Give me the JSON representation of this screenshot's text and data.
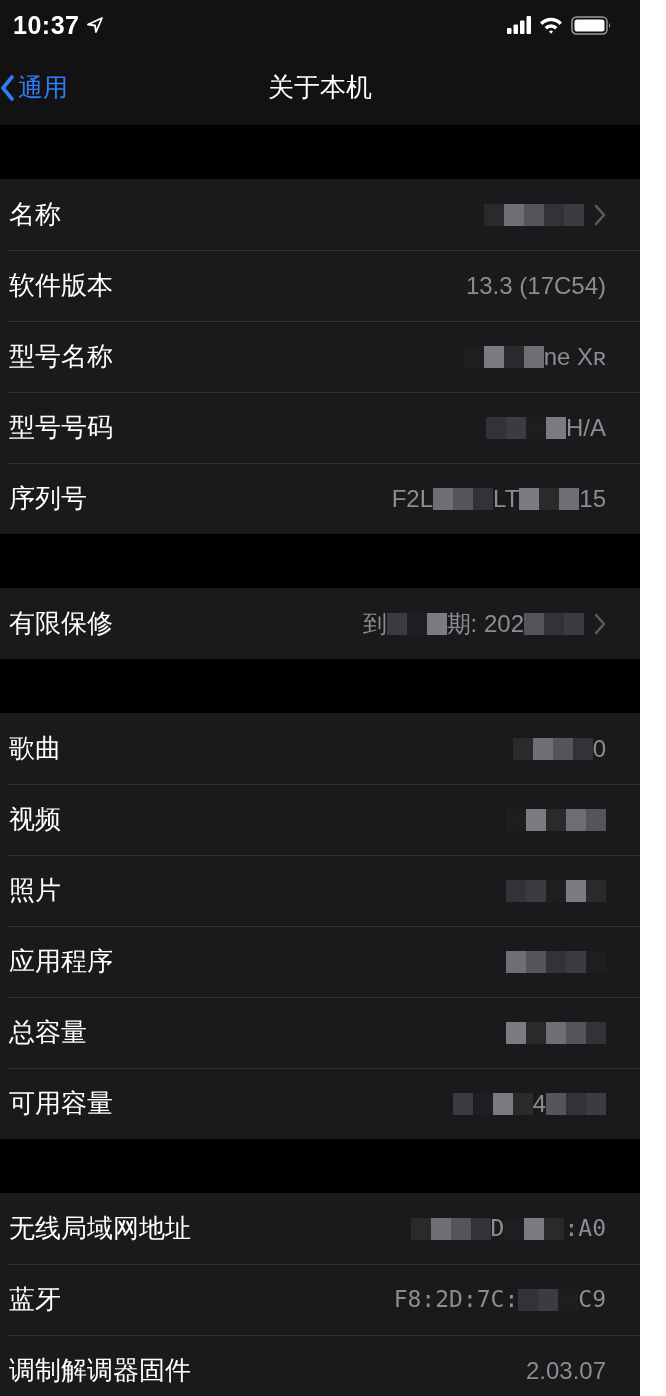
{
  "status_bar": {
    "time": "10:37"
  },
  "nav": {
    "back": "通用",
    "title": "关于本机"
  },
  "groups": [
    {
      "rows": [
        {
          "label": "名称",
          "disclosure": true,
          "value": [
            {
              "kind": "mosaic"
            }
          ]
        },
        {
          "label": "软件版本",
          "disclosure": false,
          "value": [
            {
              "kind": "text",
              "text": "13.3 (17C54)"
            }
          ]
        },
        {
          "label": "型号名称",
          "disclosure": false,
          "value": [
            {
              "kind": "mosaic"
            },
            {
              "kind": "text",
              "text": "ne Xʀ"
            }
          ]
        },
        {
          "label": "型号号码",
          "disclosure": false,
          "value": [
            {
              "kind": "mosaic"
            },
            {
              "kind": "text",
              "text": "H/A"
            }
          ]
        },
        {
          "label": "序列号",
          "disclosure": false,
          "value": [
            {
              "kind": "text",
              "text": "F2L"
            },
            {
              "kind": "mosaic"
            },
            {
              "kind": "text",
              "text": "LT"
            },
            {
              "kind": "mosaic"
            },
            {
              "kind": "text",
              "text": "15"
            }
          ]
        }
      ]
    },
    {
      "rows": [
        {
          "label": "有限保修",
          "disclosure": true,
          "value": [
            {
              "kind": "text",
              "text": "到"
            },
            {
              "kind": "mosaic"
            },
            {
              "kind": "text",
              "text": "期: 202"
            },
            {
              "kind": "mosaic"
            }
          ]
        }
      ]
    },
    {
      "rows": [
        {
          "label": "歌曲",
          "disclosure": false,
          "value": [
            {
              "kind": "mosaic"
            },
            {
              "kind": "text",
              "text": "0"
            }
          ]
        },
        {
          "label": "视频",
          "disclosure": false,
          "value": [
            {
              "kind": "mosaic"
            }
          ]
        },
        {
          "label": "照片",
          "disclosure": false,
          "value": [
            {
              "kind": "mosaic"
            }
          ]
        },
        {
          "label": "应用程序",
          "disclosure": false,
          "value": [
            {
              "kind": "mosaic"
            }
          ]
        },
        {
          "label": "总容量",
          "disclosure": false,
          "value": [
            {
              "kind": "mosaic"
            }
          ]
        },
        {
          "label": "可用容量",
          "disclosure": false,
          "value": [
            {
              "kind": "mosaic"
            },
            {
              "kind": "text",
              "text": "4"
            },
            {
              "kind": "mosaic"
            }
          ]
        }
      ]
    },
    {
      "rows": [
        {
          "label": "无线局域网地址",
          "disclosure": false,
          "value": [
            {
              "kind": "mosaic"
            },
            {
              "kind": "mono",
              "text": "D"
            },
            {
              "kind": "mosaic"
            },
            {
              "kind": "mono",
              "text": ":A0"
            }
          ]
        },
        {
          "label": "蓝牙",
          "disclosure": false,
          "value": [
            {
              "kind": "mono",
              "text": "F8:2D:7C:"
            },
            {
              "kind": "mosaic"
            },
            {
              "kind": "mono",
              "text": "C9"
            }
          ]
        },
        {
          "label": "调制解调器固件",
          "disclosure": false,
          "value": [
            {
              "kind": "text",
              "text": "2.03.07"
            }
          ]
        }
      ]
    }
  ]
}
